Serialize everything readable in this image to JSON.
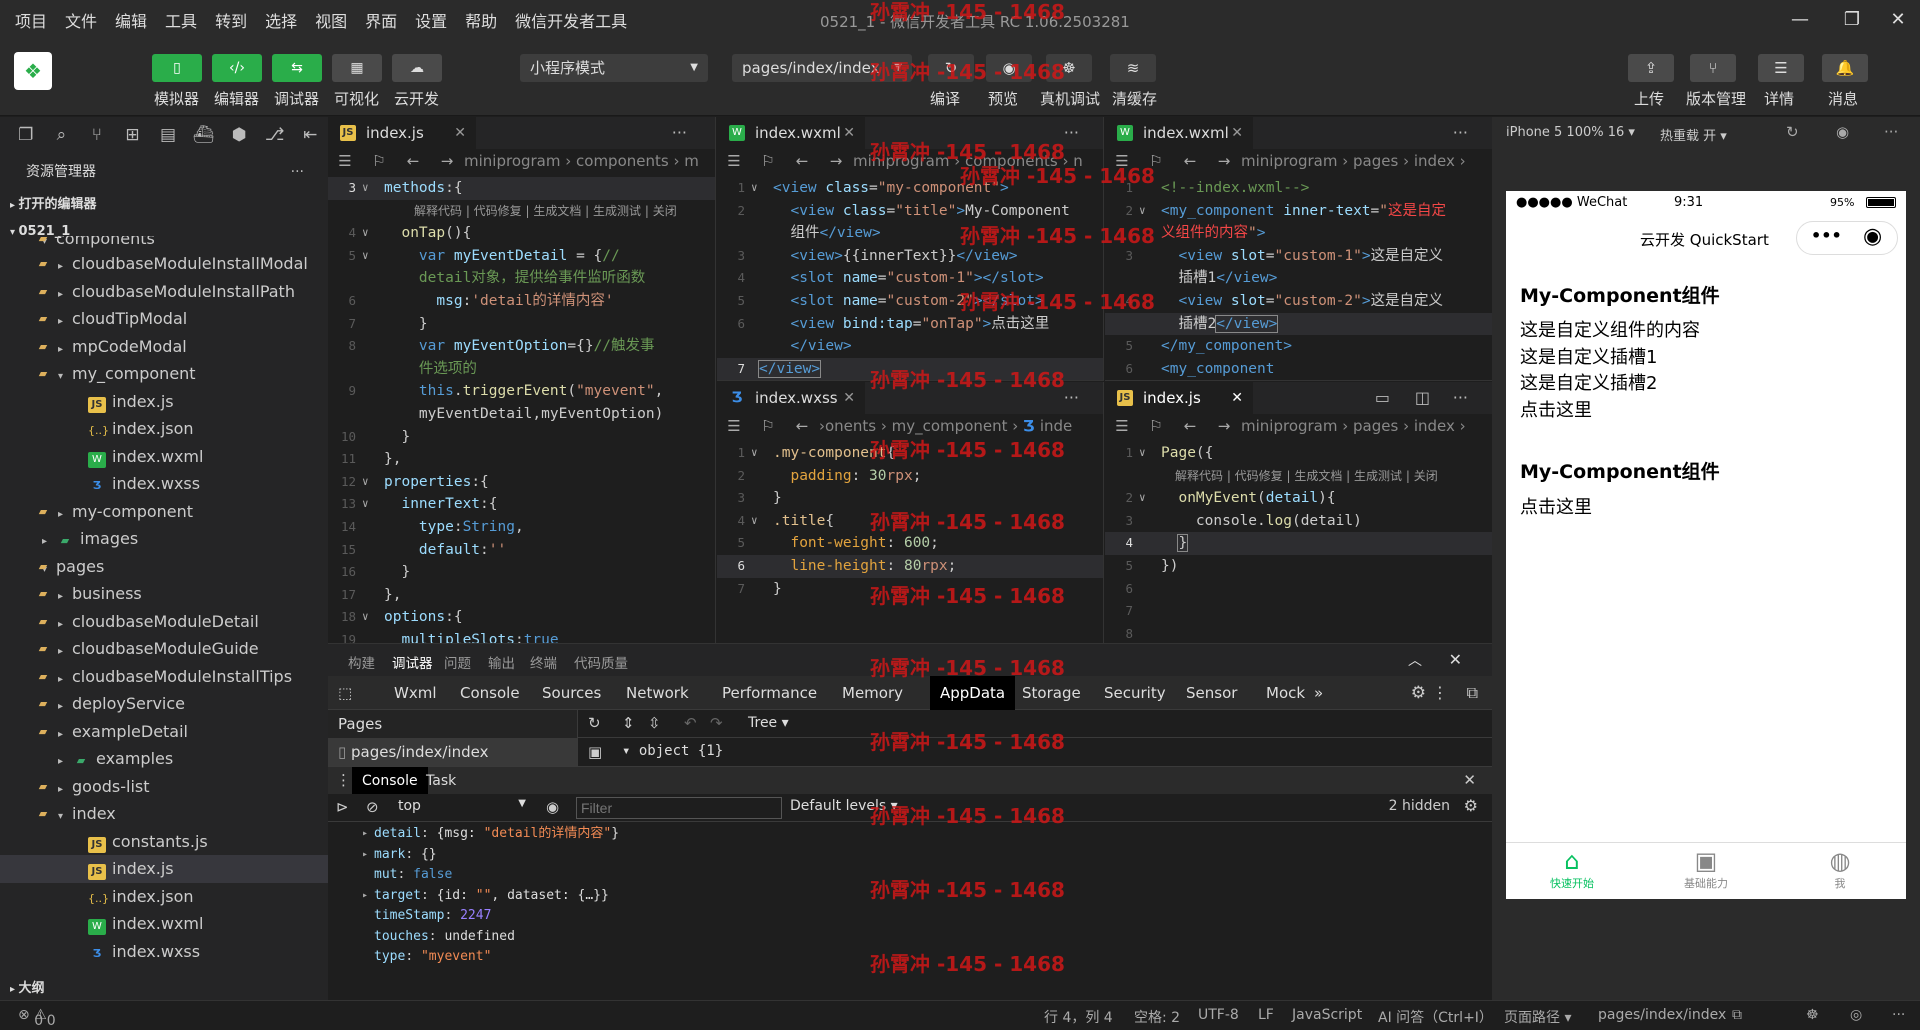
{
  "menu": [
    "项目",
    "文件",
    "编辑",
    "工具",
    "转到",
    "选择",
    "视图",
    "界面",
    "设置",
    "帮助",
    "微信开发者工具"
  ],
  "window_title": "0521_1 - 微信开发者工具 RC 1.06.2503281",
  "window_controls": {
    "minimize": "—",
    "maximize": "❐",
    "close": "✕"
  },
  "toolbar": {
    "left": [
      {
        "label": "模拟器",
        "icon": "phone-icon"
      },
      {
        "label": "编辑器",
        "icon": "code-icon"
      },
      {
        "label": "调试器",
        "icon": "debugger-icon"
      },
      {
        "label": "可视化",
        "icon": "layout-icon"
      },
      {
        "label": "云开发",
        "icon": "cloud-icon"
      }
    ],
    "mode_select": "小程序模式",
    "page_select": "pages/index/index",
    "center": [
      {
        "label": "编译",
        "icon": "refresh-icon"
      },
      {
        "label": "预览",
        "icon": "eye-icon"
      },
      {
        "label": "真机调试",
        "icon": "bug-icon"
      },
      {
        "label": "清缓存",
        "icon": "layers-icon"
      }
    ],
    "right": [
      {
        "label": "上传",
        "icon": "upload-icon"
      },
      {
        "label": "版本管理",
        "icon": "branch-icon"
      },
      {
        "label": "详情",
        "icon": "menu-icon"
      },
      {
        "label": "消息",
        "icon": "bell-icon"
      }
    ]
  },
  "explorer": {
    "title": "资源管理器",
    "open_editors": "打开的编辑器",
    "project": "0521_1",
    "outline": "大纲",
    "items": [
      {
        "label": "components",
        "type": "fold",
        "depth": 2,
        "arrow": "▾",
        "partial": true
      },
      {
        "label": "cloudbaseModuleInstallModal",
        "type": "fold",
        "depth": 3,
        "arrow": "▸"
      },
      {
        "label": "cloudbaseModuleInstallPath",
        "type": "fold",
        "depth": 3,
        "arrow": "▸"
      },
      {
        "label": "cloudTipModal",
        "type": "fold",
        "depth": 3,
        "arrow": "▸"
      },
      {
        "label": "mpCodeModal",
        "type": "fold",
        "depth": 3,
        "arrow": "▸"
      },
      {
        "label": "my_component",
        "type": "fold",
        "depth": 3,
        "arrow": "▾"
      },
      {
        "label": "index.js",
        "type": "js",
        "depth": 4,
        "arrow": ""
      },
      {
        "label": "index.json",
        "type": "json",
        "depth": 4,
        "arrow": ""
      },
      {
        "label": "index.wxml",
        "type": "wxml",
        "depth": 4,
        "arrow": ""
      },
      {
        "label": "index.wxss",
        "type": "wxss",
        "depth": 4,
        "arrow": ""
      },
      {
        "label": "my-component",
        "type": "fold",
        "depth": 3,
        "arrow": "▸"
      },
      {
        "label": "images",
        "type": "foldg",
        "depth": 2,
        "arrow": "▸"
      },
      {
        "label": "pages",
        "type": "fold",
        "depth": 2,
        "arrow": "▾"
      },
      {
        "label": "business",
        "type": "fold",
        "depth": 3,
        "arrow": "▸"
      },
      {
        "label": "cloudbaseModuleDetail",
        "type": "fold",
        "depth": 3,
        "arrow": "▸"
      },
      {
        "label": "cloudbaseModuleGuide",
        "type": "fold",
        "depth": 3,
        "arrow": "▸"
      },
      {
        "label": "cloudbaseModuleInstallTips",
        "type": "fold",
        "depth": 3,
        "arrow": "▸"
      },
      {
        "label": "deployService",
        "type": "fold",
        "depth": 3,
        "arrow": "▸"
      },
      {
        "label": "exampleDetail",
        "type": "fold",
        "depth": 3,
        "arrow": "▸"
      },
      {
        "label": "examples",
        "type": "foldg",
        "depth": 3,
        "arrow": "▸"
      },
      {
        "label": "goods-list",
        "type": "fold",
        "depth": 3,
        "arrow": "▸"
      },
      {
        "label": "index",
        "type": "fold",
        "depth": 3,
        "arrow": "▾"
      },
      {
        "label": "constants.js",
        "type": "js",
        "depth": 4,
        "arrow": ""
      },
      {
        "label": "index.js",
        "type": "js",
        "depth": 4,
        "arrow": "",
        "selected": true
      },
      {
        "label": "index.json",
        "type": "json",
        "depth": 4,
        "arrow": ""
      },
      {
        "label": "index.wxml",
        "type": "wxml",
        "depth": 4,
        "arrow": ""
      },
      {
        "label": "index.wxss",
        "type": "wxss",
        "depth": 4,
        "arrow": ""
      }
    ]
  },
  "editors": {
    "left": {
      "tab": "index.js",
      "crumb": "miniprogram › components › m",
      "codelens": "解释代码 | 代码修复 | 生成文档 | 生成测试 | 关闭"
    },
    "top_mid": {
      "tab": "index.wxml",
      "crumb": "miniprogram › components › n"
    },
    "top_right": {
      "tab": "index.wxml",
      "crumb": "miniprogram › pages › index ›"
    },
    "bot_mid": {
      "tab": "index.wxss",
      "crumb": "›onents › my_component › ",
      "crumb_tail": "inde"
    },
    "bot_right": {
      "tab": "index.js",
      "crumb": "miniprogram › pages › index ›",
      "codelens": "解释代码 | 代码修复 | 生成文档 | 生成测试 | 关闭"
    }
  },
  "watermark": "孙霄冲 -145 - 1468",
  "bottom": {
    "tabs": [
      "构建",
      "调试器",
      "问题",
      "输出",
      "终端",
      "代码质量"
    ],
    "devtools_tabs": [
      "Wxml",
      "Console",
      "Sources",
      "Network",
      "Performance",
      "Memory",
      "AppData",
      "Storage",
      "Security",
      "Sensor",
      "Mock",
      "»"
    ],
    "pages_label": "Pages",
    "page_item": "pages/index/index",
    "view_mode": "Tree",
    "object_label": "object {1}",
    "console_tabs": [
      "Console",
      "Task"
    ],
    "context": "top",
    "filter_placeholder": "Filter",
    "levels": "Default levels",
    "hidden": "2 hidden",
    "log": [
      {
        "key": "detail",
        "value": "{msg: ",
        "str": "\"detail的详情内容\"",
        "tail": "}",
        "arrow": "▸"
      },
      {
        "key": "mark",
        "value": "{}",
        "str": "",
        "tail": "",
        "arrow": "▸"
      },
      {
        "key": "mut",
        "value": "",
        "str": "",
        "tail": "",
        "kw": "false",
        "arrow": ""
      },
      {
        "key": "target",
        "value": "{id: ",
        "str": "\"\"",
        "tail": ", dataset: {…}}",
        "arrow": "▸"
      },
      {
        "key": "timeStamp",
        "value": "",
        "str": "",
        "tail": "",
        "num": "2247",
        "arrow": ""
      },
      {
        "key": "touches",
        "value": "undefined",
        "str": "",
        "tail": "",
        "arrow": ""
      },
      {
        "key": "type",
        "value": "",
        "str": "\"myevent\"",
        "tail": "",
        "arrow": ""
      }
    ]
  },
  "simulator": {
    "device": "iPhone 5 100% 16 ▾",
    "hotreload": "热重载 开 ▾",
    "status_carrier": "●●●●● WeChat",
    "status_time": "9:31",
    "status_battery": "95%",
    "nav_title": "云开发 QuickStart",
    "content": {
      "h1": "My-Component组件",
      "lines": [
        "这是自定义组件的内容",
        "这是自定义插槽1",
        "这是自定义插槽2",
        "点击这里"
      ],
      "h2": "My-Component组件",
      "line2": "点击这里"
    },
    "tabbar": [
      {
        "label": "快速开始",
        "icon": "home-icon",
        "color": "#07c160"
      },
      {
        "label": "基础能力",
        "icon": "terminal-icon",
        "color": "#888888"
      },
      {
        "label": "我",
        "icon": "user-icon",
        "color": "#888888"
      }
    ]
  },
  "status": {
    "problems_err": "0",
    "problems_warn": "0",
    "position": "行 4，列 4",
    "indent": "空格: 2",
    "encoding": "UTF-8",
    "eol": "LF",
    "language": "JavaScript",
    "ai": "AI 问答（Ctrl+I）",
    "page_path_label": "页面路径 ▾",
    "page_path": "pages/index/index"
  }
}
